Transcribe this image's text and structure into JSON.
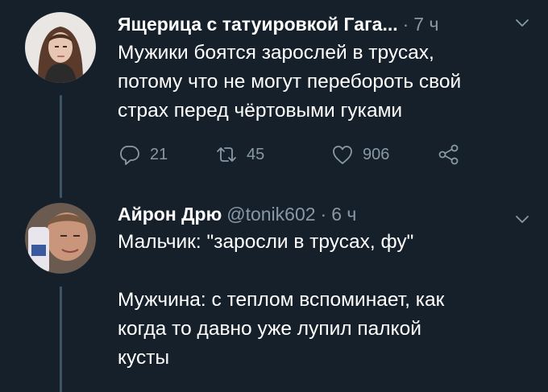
{
  "tweets": [
    {
      "display_name": "Ящерица с татуировкой Гага...",
      "handle": "",
      "separator": "·",
      "time": "7 ч",
      "text": "Мужики боятся зарослей в трусах,\nпотому что не могут перебороть свой\nстрах перед чёртовыми гуками",
      "replies": "21",
      "retweets": "45",
      "likes": "906"
    },
    {
      "display_name": "Айрон Дрю",
      "handle": "@tonik602",
      "separator": "·",
      "time": "6 ч",
      "text": "Мальчик: \"заросли в трусах, фу\"\n\nМужчина: с теплом вспоминает, как\nкогда то давно уже лупил палкой\nкусты"
    }
  ],
  "icons": {
    "reply": "reply-icon",
    "retweet": "retweet-icon",
    "like": "like-icon",
    "share": "share-icon",
    "menu": "chevron-down-icon"
  },
  "colors": {
    "background": "#15202b",
    "secondary_text": "#8899a6",
    "thread_line": "#3d5466"
  }
}
